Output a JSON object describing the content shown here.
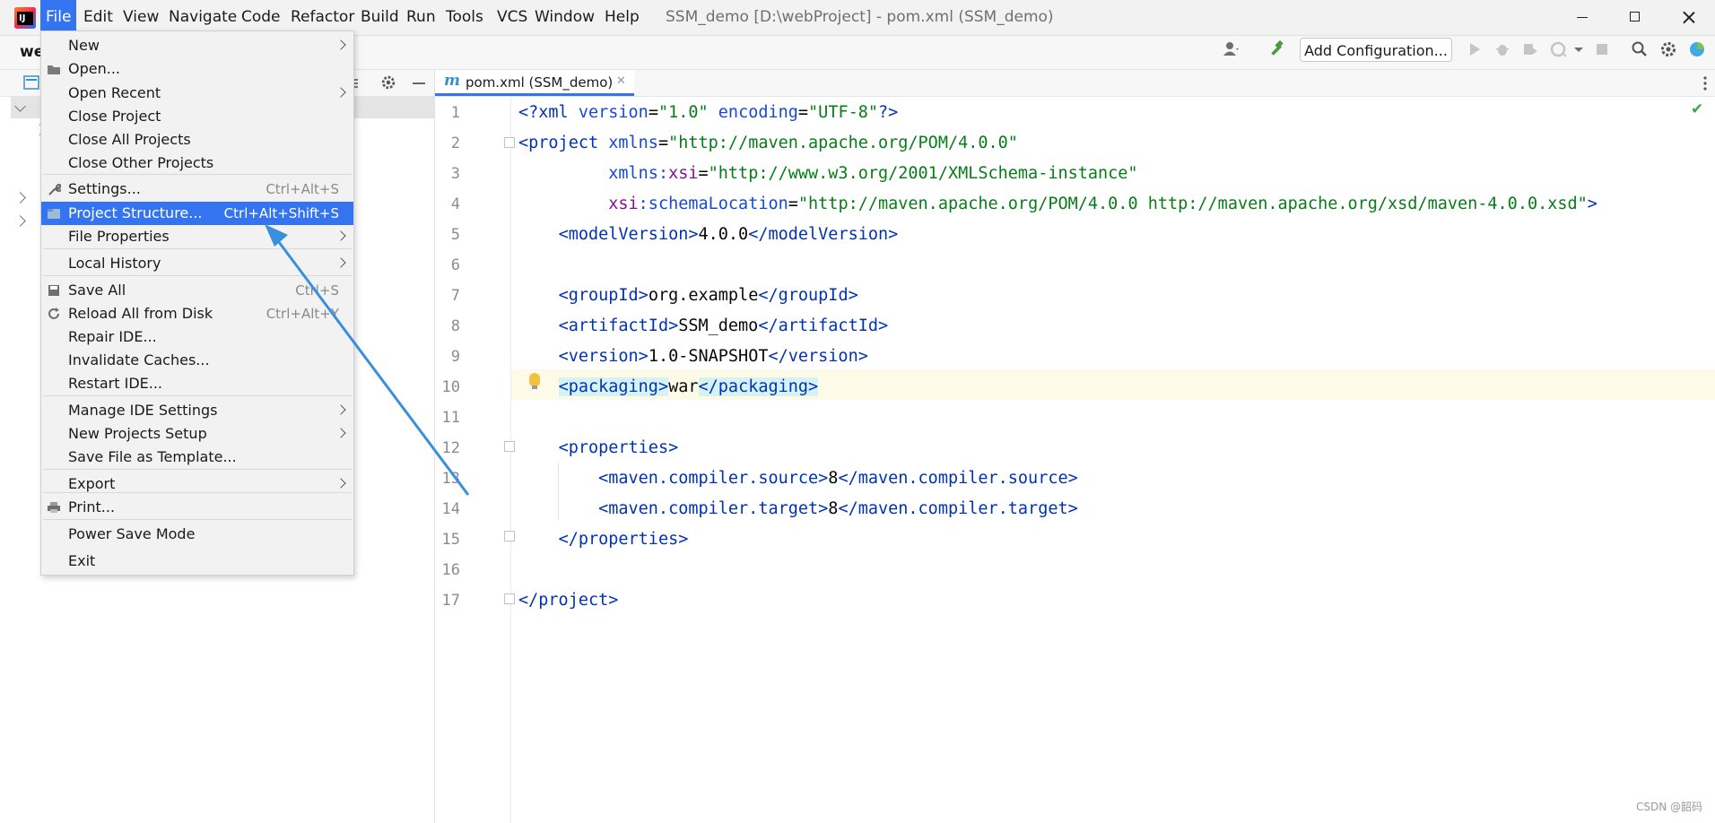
{
  "window": {
    "title": "SSM_demo [D:\\webProject] - pom.xml (SSM_demo)",
    "project_label": "we"
  },
  "menubar": [
    "File",
    "Edit",
    "View",
    "Navigate",
    "Code",
    "Refactor",
    "Build",
    "Run",
    "Tools",
    "VCS",
    "Window",
    "Help"
  ],
  "toolbar": {
    "add_configuration": "Add Configuration..."
  },
  "file_menu": {
    "items": [
      {
        "label": "New",
        "shortcut": "",
        "submenu": true,
        "icon": ""
      },
      {
        "label": "Open...",
        "shortcut": "",
        "submenu": false,
        "icon": "folder-icon"
      },
      {
        "label": "Open Recent",
        "shortcut": "",
        "submenu": true,
        "icon": ""
      },
      {
        "label": "Close Project",
        "shortcut": "",
        "submenu": false,
        "icon": ""
      },
      {
        "label": "Close All Projects",
        "shortcut": "",
        "submenu": false,
        "icon": ""
      },
      {
        "label": "Close Other Projects",
        "shortcut": "",
        "submenu": false,
        "icon": ""
      },
      {
        "label": "Settings...",
        "shortcut": "Ctrl+Alt+S",
        "submenu": false,
        "icon": "wrench-icon"
      },
      {
        "label": "Project Structure...",
        "shortcut": "Ctrl+Alt+Shift+S",
        "submenu": false,
        "icon": "project-structure-icon",
        "selected": true
      },
      {
        "label": "File Properties",
        "shortcut": "",
        "submenu": true,
        "icon": ""
      },
      {
        "label": "Local History",
        "shortcut": "",
        "submenu": true,
        "icon": ""
      },
      {
        "label": "Save All",
        "shortcut": "Ctrl+S",
        "submenu": false,
        "icon": "save-icon"
      },
      {
        "label": "Reload All from Disk",
        "shortcut": "Ctrl+Alt+Y",
        "submenu": false,
        "icon": "reload-icon"
      },
      {
        "label": "Repair IDE...",
        "shortcut": "",
        "submenu": false,
        "icon": ""
      },
      {
        "label": "Invalidate Caches...",
        "shortcut": "",
        "submenu": false,
        "icon": ""
      },
      {
        "label": "Restart IDE...",
        "shortcut": "",
        "submenu": false,
        "icon": ""
      },
      {
        "label": "Manage IDE Settings",
        "shortcut": "",
        "submenu": true,
        "icon": ""
      },
      {
        "label": "New Projects Setup",
        "shortcut": "",
        "submenu": true,
        "icon": ""
      },
      {
        "label": "Save File as Template...",
        "shortcut": "",
        "submenu": false,
        "icon": ""
      },
      {
        "label": "Export",
        "shortcut": "",
        "submenu": true,
        "icon": ""
      },
      {
        "label": "Print...",
        "shortcut": "",
        "submenu": false,
        "icon": "printer-icon"
      },
      {
        "label": "Power Save Mode",
        "shortcut": "",
        "submenu": false,
        "icon": ""
      },
      {
        "label": "Exit",
        "shortcut": "",
        "submenu": false,
        "icon": ""
      }
    ]
  },
  "editor": {
    "tab_label": "pom.xml (SSM_demo)",
    "line_numbers": [
      "1",
      "2",
      "3",
      "4",
      "5",
      "6",
      "7",
      "8",
      "9",
      "10",
      "11",
      "12",
      "13",
      "14",
      "15",
      "16",
      "17"
    ],
    "highlighted_line": "10"
  },
  "watermark": "CSDN @韶码"
}
